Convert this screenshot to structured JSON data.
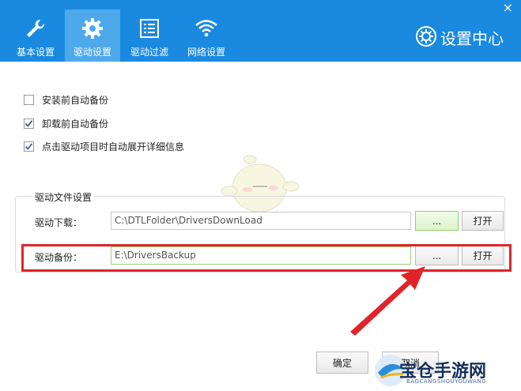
{
  "header": {
    "tabs": [
      {
        "label": "基本设置",
        "icon": "wrench-icon"
      },
      {
        "label": "驱动设置",
        "icon": "gear-icon",
        "active": true
      },
      {
        "label": "驱动过滤",
        "icon": "list-icon"
      },
      {
        "label": "网络设置",
        "icon": "wifi-icon"
      }
    ],
    "title": "设置中心",
    "close_label": "×"
  },
  "options": [
    {
      "label": "安装前自动备份",
      "checked": false
    },
    {
      "label": "卸载前自动备份",
      "checked": true
    },
    {
      "label": "点击驱动项目时自动展开详细信息",
      "checked": true
    }
  ],
  "files": {
    "group_title": "驱动文件设置",
    "download_label": "驱动下载：",
    "download_path": "C:\\DTLFolder\\DriversDownLoad",
    "backup_label": "驱动备份：",
    "backup_path": "E:\\DriversBackup",
    "browse_label": "...",
    "open_label": "打开"
  },
  "footer": {
    "ok_label": "确定",
    "cancel_label": "取消"
  },
  "watermark": {
    "text": "宝仓手游网",
    "sub": "BAOCANGSHOUYOUWANG"
  },
  "colors": {
    "header_bg": "#1a8ae0",
    "active_tab_bg": "#4ea8ec",
    "highlight_red": "#e0252a",
    "accent_green": "#8fcf6a"
  }
}
